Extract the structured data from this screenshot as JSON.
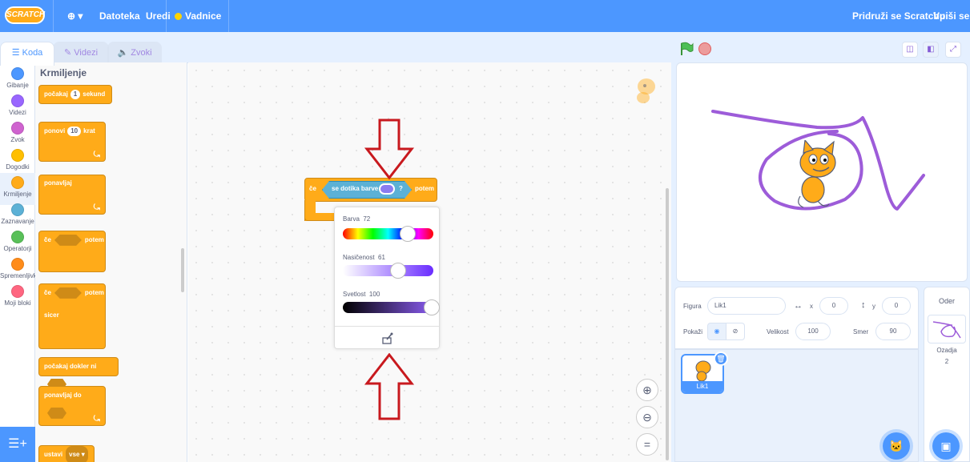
{
  "menubar": {
    "logo": "SCRATCH",
    "globe": "⊕ ▾",
    "file": "Datoteka",
    "edit": "Uredi",
    "tutorials": "Vadnice",
    "join": "Pridruži se Scratchu",
    "signin": "Vpiši se"
  },
  "tabs": {
    "code": "Koda",
    "costumes": "Videzi",
    "sounds": "Zvoki"
  },
  "categories": [
    {
      "label": "Gibanje",
      "color": "#4c97ff"
    },
    {
      "label": "Videzi",
      "color": "#9966ff"
    },
    {
      "label": "Zvok",
      "color": "#cf63cf"
    },
    {
      "label": "Dogodki",
      "color": "#ffbf00"
    },
    {
      "label": "Krmiljenje",
      "color": "#ffab19"
    },
    {
      "label": "Zaznavanje",
      "color": "#5cb1d6"
    },
    {
      "label": "Operatorji",
      "color": "#59c059"
    },
    {
      "label": "Spremenljivke",
      "color": "#ff8c1a"
    },
    {
      "label": "Moji bloki",
      "color": "#ff6680"
    }
  ],
  "palette": {
    "title": "Krmiljenje",
    "wait": "počakaj",
    "wait_value": "1",
    "wait_unit": "sekund",
    "repeat": "ponovi",
    "repeat_value": "10",
    "repeat_unit": "krat",
    "forever": "ponavljaj",
    "if": "če",
    "then": "potem",
    "if2": "če",
    "then2": "potem",
    "else": "sicer",
    "wait_until": "počakaj dokler ni",
    "repeat_until": "ponavljaj do",
    "stop": "ustavi",
    "stop_value": "vse ▾"
  },
  "script": {
    "if": "če",
    "touching": "se dotika barve",
    "question": "?",
    "then": "potem"
  },
  "color_picker": {
    "hue_label": "Barva",
    "hue_value": "72",
    "saturation_label": "Nasičenost",
    "saturation_value": "61",
    "brightness_label": "Svetlost",
    "brightness_value": "100",
    "hue_fraction": 0.72,
    "saturation_fraction": 0.61,
    "brightness_fraction": 1.0
  },
  "sprite_info": {
    "sprite_label": "Figura",
    "sprite_name": "Lik1",
    "x_label": "x",
    "x_value": "0",
    "y_label": "y",
    "y_value": "0",
    "show_label": "Pokaži",
    "size_label": "Velikost",
    "size_value": "100",
    "direction_label": "Smer",
    "direction_value": "90"
  },
  "sprite_tile": {
    "name": "Lik1"
  },
  "backdrop": {
    "title": "Oder",
    "label": "Ozadja",
    "count": "2"
  },
  "colors": {
    "accent": "#4c97ff",
    "control": "#ffab19",
    "annotation": "#c8191e",
    "drawing": "#9d5cd9"
  }
}
